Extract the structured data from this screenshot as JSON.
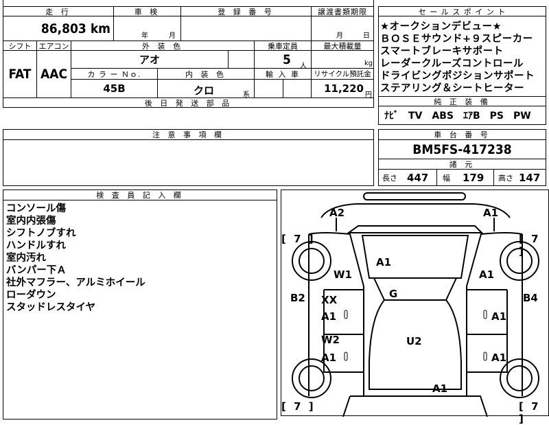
{
  "header_row": {
    "mileage_label": "走 行",
    "inspection_label": "車 検",
    "registration_label": "登 録 番 号",
    "transfer_deadline_label": "譲渡書類期限",
    "sales_point_label": "セ ー ル ス ポ イ ン ト"
  },
  "mileage": {
    "value": "86,803",
    "unit": "km"
  },
  "inspection": {
    "year_label": "年",
    "month_label": "月"
  },
  "transfer_deadline": {
    "month_label": "月",
    "day_label": "日"
  },
  "row2_labels": {
    "shift": "シフト",
    "aircon": "エアコン",
    "exterior_color": "外 装 色",
    "capacity": "乗車定員",
    "max_load": "最大積載量"
  },
  "shift": "FAT",
  "aircon": "AAC",
  "exterior_color": "アオ",
  "capacity": {
    "value": "5",
    "unit": "人"
  },
  "max_load": {
    "unit": "kg"
  },
  "row3_labels": {
    "color_no": "カ ラ ー Ｎｏ.",
    "interior_color": "内 装 色",
    "import": "輸 入 車",
    "recycle": "リサイクル預託金"
  },
  "color_no": "45B",
  "interior_color": {
    "value": "クロ",
    "suffix": "系"
  },
  "recycle": {
    "value": "11,220",
    "unit": "円"
  },
  "delivery_parts_label": "後 日 発 送 部 品",
  "sales_points": [
    "★オークションデビュー★",
    "ＢＯＳＥサウンド+９スピーカー",
    "スマートブレーキサポート",
    "レーダークルーズコントロール",
    "ドライビングポジションサポート",
    "ステアリング＆シートヒーター"
  ],
  "standard_equipment_label": "純 正 装 備",
  "standard_equipment": "ﾅﾋﾞ　TV　ABS　ｴｱB　PS　PW",
  "notes_label": "注 意 事 項 欄",
  "chassis_label": "車 台 番 号",
  "chassis_number": "BM5FS-417238",
  "specs_label": "諸 元",
  "specs": {
    "length_label": "長さ",
    "length": "447",
    "width_label": "幅",
    "width": "179",
    "height_label": "高さ",
    "height": "147"
  },
  "inspector_label": "検 査 員 記 入 欄",
  "inspector_notes": [
    "コンソール傷",
    "室内内張傷",
    "シフトノブすれ",
    "ハンドルすれ",
    "室内汚れ",
    "バンパー下Ａ",
    "社外マフラー、アルミホイール",
    "ローダウン",
    "スタッドレスタイヤ"
  ],
  "damage_marks": {
    "front_left_bumper": "A2",
    "front_right_bumper": "A1",
    "hood": "A1",
    "left_front_fender": "W1",
    "right_front_fender": "A1",
    "windshield": "G",
    "left_pillar": "B2",
    "right_pillar": "B4",
    "left_front_door_1": "XX",
    "left_front_door_2": "A1",
    "right_front_door": "A1",
    "left_rear_door_1": "W2",
    "left_rear_door_2": "A1",
    "right_rear_door": "A1",
    "roof": "U2",
    "rear": "A1",
    "tire_fl": "[ 7 ]",
    "tire_fr": "[ 7 ]",
    "tire_rl": "[ 7 ]",
    "tire_rr": "[ 7 ]"
  }
}
